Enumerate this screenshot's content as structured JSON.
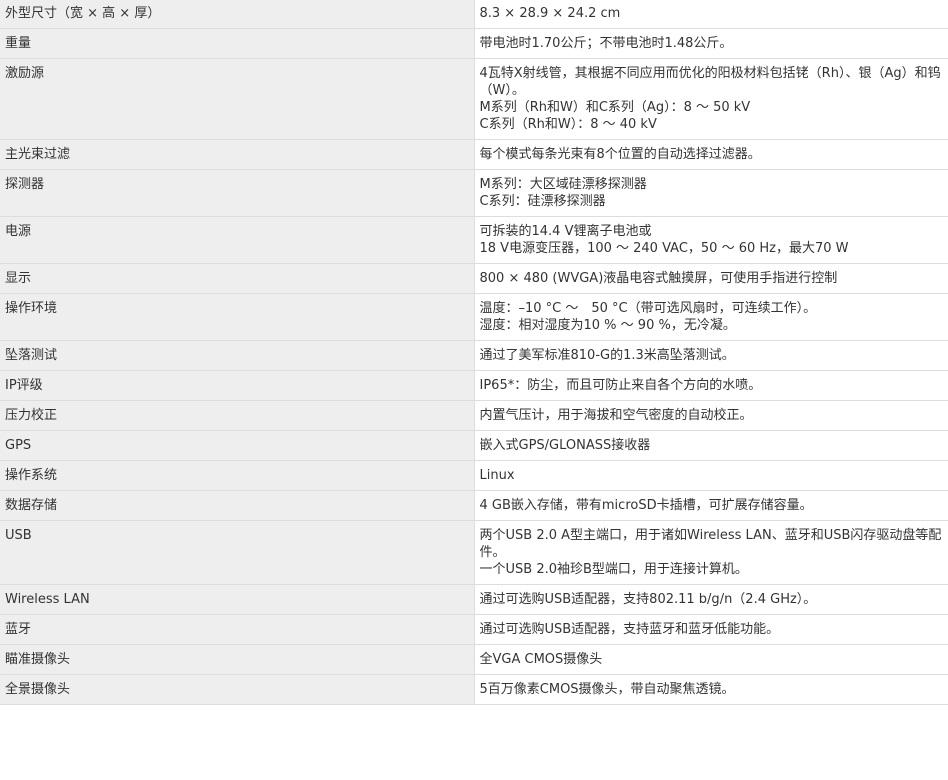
{
  "spec_rows": [
    {
      "label": "外型尺寸（宽 × 高 × 厚）",
      "lines": [
        "8.3 × 28.9 × 24.2 cm"
      ]
    },
    {
      "label": "重量",
      "lines": [
        "带电池时1.70公斤；不带电池时1.48公斤。"
      ]
    },
    {
      "label": "激励源",
      "lines": [
        "4瓦特X射线管，其根据不同应用而优化的阳极材料包括铑（Rh）、银（Ag）和钨（W）。",
        "M系列（Rh和W）和C系列（Ag）：8 ～ 50 kV",
        "C系列（Rh和W）：8 ～ 40 kV"
      ]
    },
    {
      "label": "主光束过滤",
      "lines": [
        "每个模式每条光束有8个位置的自动选择过滤器。"
      ]
    },
    {
      "label": "探测器",
      "lines": [
        "M系列：大区域硅漂移探测器",
        "C系列：硅漂移探测器"
      ]
    },
    {
      "label": "电源",
      "lines": [
        "可拆装的14.4 V锂离子电池或",
        "18 V电源变压器，100 ～ 240 VAC，50 ～ 60 Hz，最大70 W"
      ]
    },
    {
      "label": "显示",
      "lines": [
        "800 × 480 (WVGA)液晶电容式触摸屏，可使用手指进行控制"
      ]
    },
    {
      "label": "操作环境",
      "lines": [
        "温度：–10 °C ～　50 °C（带可选风扇时，可连续工作）。",
        "湿度：相对湿度为10 % ～ 90 %，无冷凝。"
      ]
    },
    {
      "label": "坠落测试",
      "lines": [
        "通过了美军标准810-G的1.3米高坠落测试。"
      ]
    },
    {
      "label": "IP评级",
      "lines": [
        "IP65*：防尘，而且可防止来自各个方向的水喷。"
      ]
    },
    {
      "label": "压力校正",
      "lines": [
        "内置气压计，用于海拔和空气密度的自动校正。"
      ]
    },
    {
      "label": "GPS",
      "lines": [
        "嵌入式GPS/GLONASS接收器"
      ]
    },
    {
      "label": "操作系统",
      "lines": [
        "Linux"
      ]
    },
    {
      "label": "数据存储",
      "lines": [
        "4 GB嵌入存储，带有microSD卡插槽，可扩展存储容量。"
      ]
    },
    {
      "label": "USB",
      "lines": [
        "两个USB 2.0 A型主端口，用于诸如Wireless LAN、蓝牙和USB闪存驱动盘等配件。",
        "一个USB 2.0袖珍B型端口，用于连接计算机。"
      ]
    },
    {
      "label": "Wireless LAN",
      "lines": [
        "通过可选购USB适配器，支持802.11 b/g/n（2.4 GHz）。"
      ]
    },
    {
      "label": "蓝牙",
      "lines": [
        "通过可选购USB适配器，支持蓝牙和蓝牙低能功能。"
      ]
    },
    {
      "label": "瞄准摄像头",
      "lines": [
        "全VGA CMOS摄像头"
      ]
    },
    {
      "label": "全景摄像头",
      "lines": [
        "5百万像素CMOS摄像头，带自动聚焦透镜。"
      ]
    }
  ]
}
